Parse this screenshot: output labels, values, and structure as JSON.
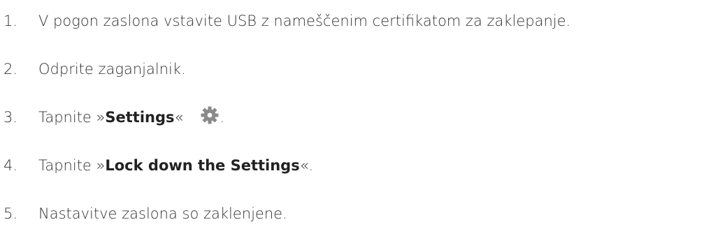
{
  "steps": [
    {
      "number": "1.",
      "text": "V pogon zaslona vstavite USB z nameščenim certifikatom za zaklepanje."
    },
    {
      "number": "2.",
      "text": "Odprite zaganjalnik."
    },
    {
      "number": "3.",
      "prefix": "Tapnite »",
      "bold": "Settings",
      "suffix": "«",
      "icon": "gear-icon",
      "end": "."
    },
    {
      "number": "4.",
      "prefix": "Tapnite »",
      "bold": "Lock down the Settings",
      "suffix": "«."
    },
    {
      "number": "5.",
      "text": "Nastavitve zaslona so zaklenjene."
    }
  ],
  "colors": {
    "text": "#333333",
    "icon": "#8a8a8a"
  }
}
